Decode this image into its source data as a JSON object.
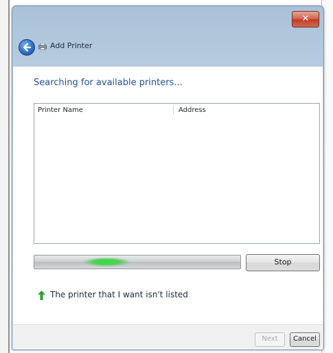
{
  "window": {
    "title": "Add Printer",
    "close_glyph": "✕"
  },
  "content": {
    "heading": "Searching for available printers..."
  },
  "printer_list": {
    "columns": [
      "Printer Name",
      "Address"
    ],
    "rows": []
  },
  "progress": {
    "state": "indeterminate"
  },
  "buttons": {
    "stop": "Stop",
    "next": "Next",
    "cancel": "Cancel"
  },
  "link": {
    "text": "The printer that I want isn't listed"
  },
  "colors": {
    "heading": "#1e4f9a",
    "progress_glow": "#33e043",
    "close_button": "#c9452e",
    "link_arrow": "#2e9e3a"
  },
  "icons": {
    "back": "back-arrow-icon",
    "printer": "printer-icon",
    "link": "green-arrow-icon",
    "close": "close-icon"
  }
}
